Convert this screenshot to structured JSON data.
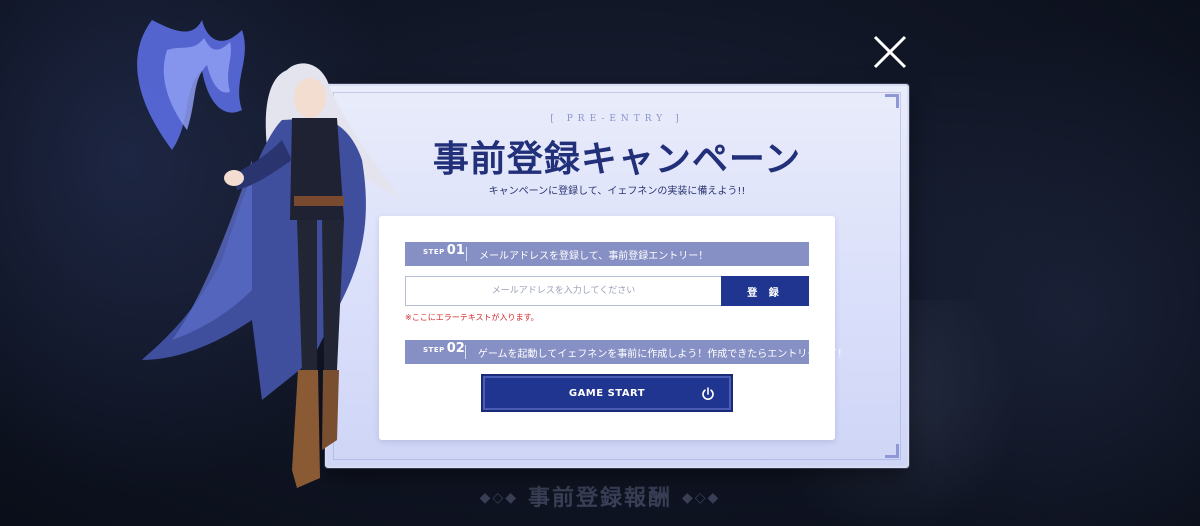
{
  "background": {
    "reward_title": "事前登録報酬"
  },
  "modal": {
    "label": "[ PRE-ENTRY ]",
    "title": "事前登録キャンペーン",
    "subtitle": "キャンペーンに登録して、イェフネンの実装に備えよう!!",
    "steps": [
      {
        "word": "STEP",
        "number": "01",
        "text": "メールアドレスを登録して、事前登録エントリー！"
      },
      {
        "word": "STEP",
        "number": "02",
        "text": "ゲームを起動してイェフネンを事前に作成しよう！作成できたらエントリー完了！"
      }
    ],
    "email_input": {
      "placeholder": "メールアドレスを入力してください",
      "value": ""
    },
    "register_label": "登 録",
    "error_text": "※ここにエラーテキストが入ります。",
    "game_start_label": "GAME START"
  },
  "colors": {
    "accent": "#1f3590",
    "step_bar": "#8790c4",
    "title": "#213079",
    "error": "#d22b2b",
    "flame": "#5b6ce0"
  },
  "icons": [
    "close-icon",
    "power-icon",
    "corner-bracket-icon"
  ]
}
